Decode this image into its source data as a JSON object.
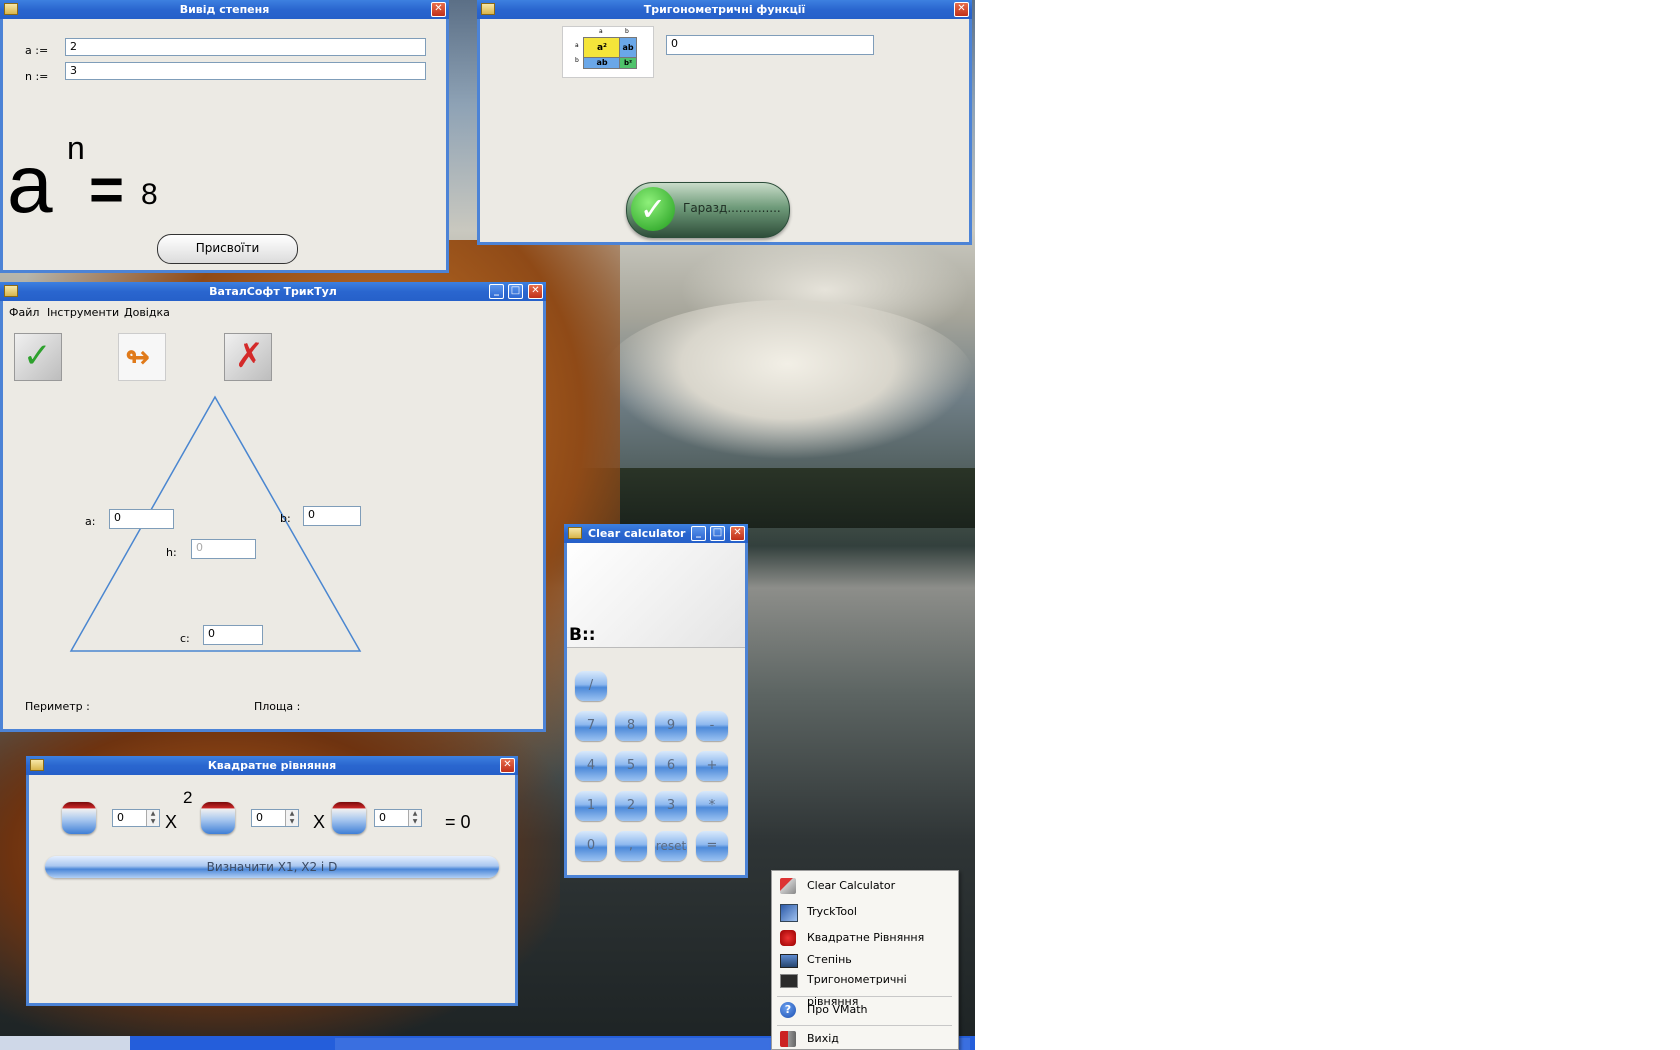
{
  "power_window": {
    "title": "Вивід степеня",
    "a_label": "a :=",
    "a_value": "2",
    "n_label": "n :=",
    "n_value": "3",
    "formula_base": "a",
    "formula_exp": "n",
    "formula_eq": "=",
    "result": "8",
    "assign_button": "Присвоїти"
  },
  "trig_window": {
    "title": "Тригонометричні функції",
    "value": "0",
    "ok_button": "Гаразд..............",
    "image_labels": {
      "a2": "a²",
      "ab": "ab",
      "ab2": "ab",
      "b2": "b²",
      "a_top": "a",
      "b_top": "b",
      "a_side": "a",
      "b_side": "b"
    }
  },
  "tricktool_window": {
    "title": "ВаталСофт ТрикТул",
    "menu": [
      "Файл",
      "Інструменти",
      "Довідка"
    ],
    "a_label": "a:",
    "a_value": "0",
    "b_label": "b:",
    "b_value": "0",
    "h_label": "h:",
    "h_value": "0",
    "c_label": "c:",
    "c_value": "0",
    "perimeter_label": "Периметр :",
    "area_label": "Площа :"
  },
  "calculator_window": {
    "title": "Clear calculator",
    "display_label": "B::",
    "buttons": [
      "/",
      "7",
      "8",
      "9",
      "-",
      "4",
      "5",
      "6",
      "+",
      "1",
      "2",
      "3",
      "*",
      "0",
      ",",
      "reset",
      "="
    ]
  },
  "quadratic_window": {
    "title": "Квадратне рівняння",
    "coef_a": "0",
    "coef_b": "0",
    "coef_c": "0",
    "x_symbol": "X",
    "x_symbol2": "X",
    "exponent": "2",
    "equals": "= 0",
    "compute_button": "Визначити X1, X2 і D"
  },
  "context_menu": {
    "items": [
      "Clear Calculator",
      "TryckTool",
      "Квадратне Рівняння",
      "Степінь",
      "Тригонометричні рівняння",
      "Про VMath",
      "Вихід"
    ]
  },
  "colors": {
    "titlebar": "#2a66cf",
    "window_bg": "#eceae4",
    "triangle": "#4a86d0"
  }
}
